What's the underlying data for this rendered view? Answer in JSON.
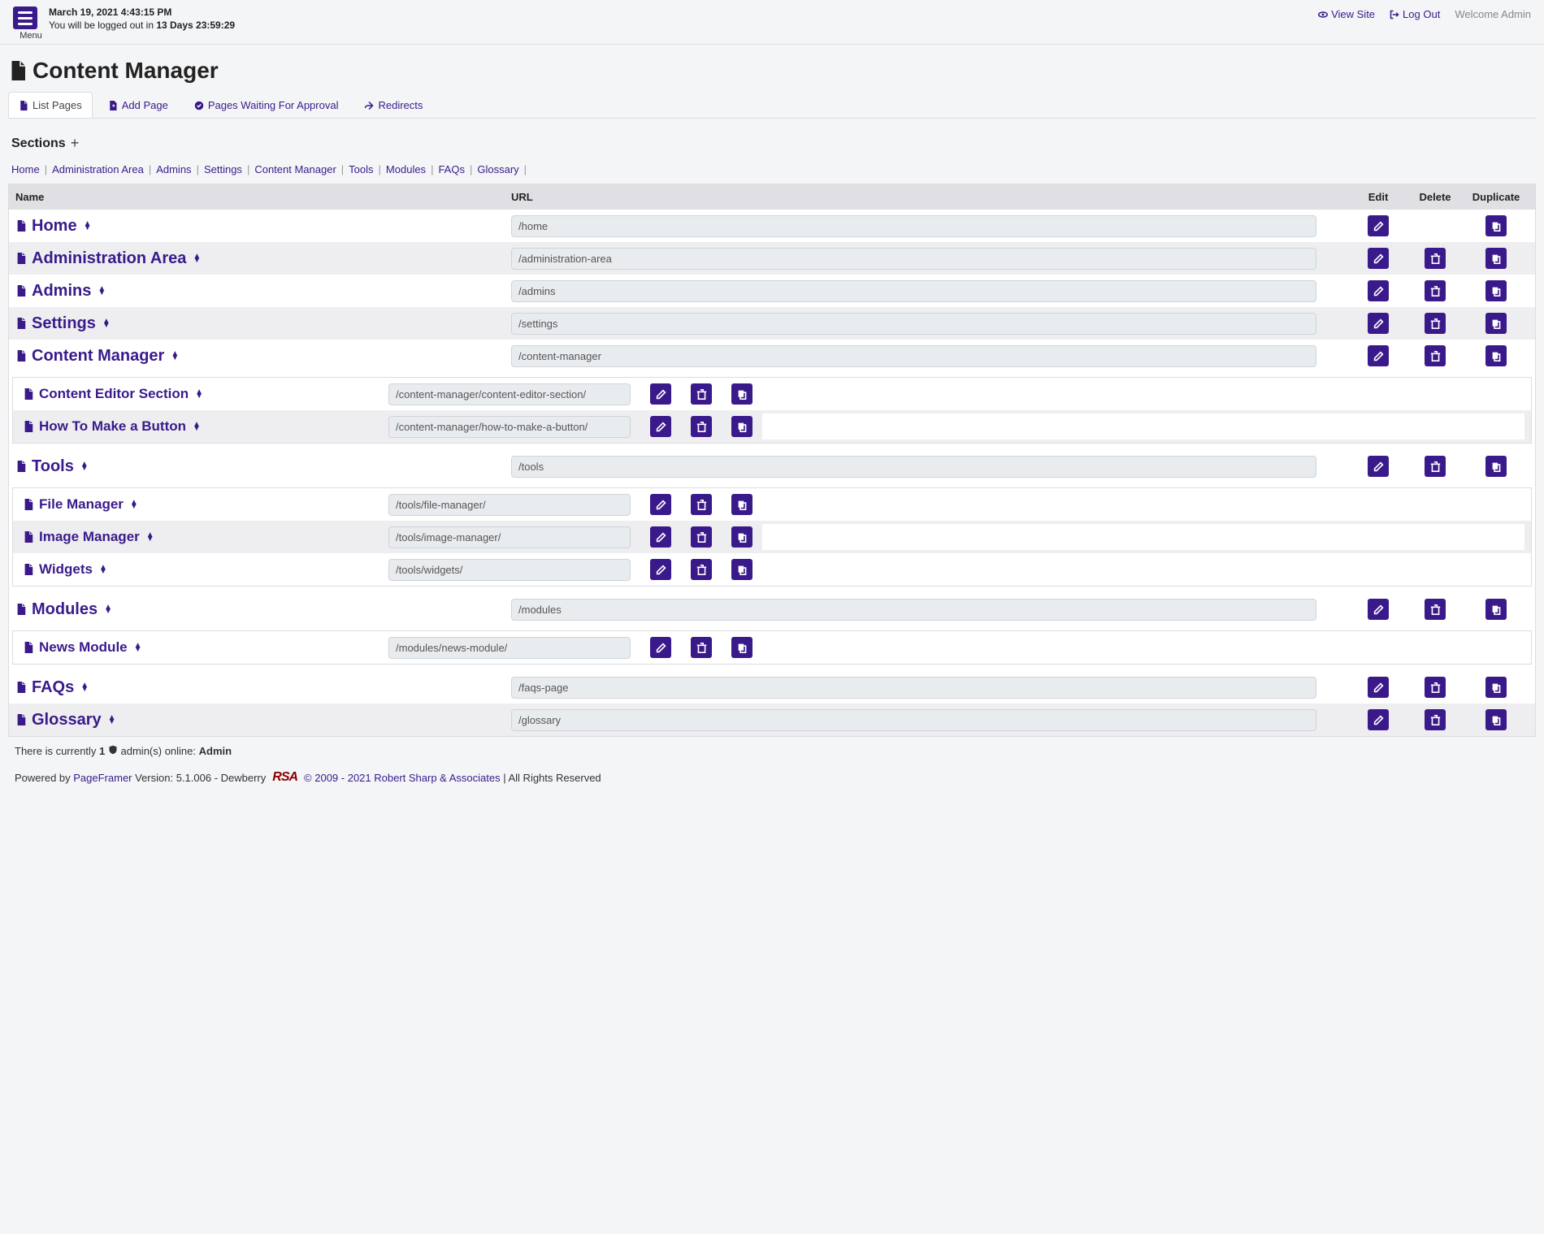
{
  "header": {
    "menu_label": "Menu",
    "datetime": "March 19, 2021 4:43:15 PM",
    "logout_prefix": "You will be logged out in ",
    "logout_countdown": "13 Days 23:59:29",
    "view_site": "View Site",
    "log_out": "Log Out",
    "welcome": "Welcome Admin"
  },
  "page": {
    "title": "Content Manager"
  },
  "tabs": [
    {
      "label": "List Pages",
      "icon": "file-icon",
      "active": true
    },
    {
      "label": "Add Page",
      "icon": "file-plus-icon"
    },
    {
      "label": "Pages Waiting For Approval",
      "icon": "check-circle-icon"
    },
    {
      "label": "Redirects",
      "icon": "redirect-icon"
    }
  ],
  "sections_label": "Sections",
  "breadcrumb": [
    "Home",
    "Administration Area",
    "Admins",
    "Settings",
    "Content Manager",
    "Tools",
    "Modules",
    "FAQs",
    "Glossary"
  ],
  "columns": {
    "name": "Name",
    "url": "URL",
    "edit": "Edit",
    "delete": "Delete",
    "duplicate": "Duplicate"
  },
  "rows": [
    {
      "name": "Home",
      "url": "/home",
      "delete": false
    },
    {
      "name": "Administration Area",
      "url": "/administration-area",
      "delete": true
    },
    {
      "name": "Admins",
      "url": "/admins",
      "delete": true
    },
    {
      "name": "Settings",
      "url": "/settings",
      "delete": true
    },
    {
      "name": "Content Manager",
      "url": "/content-manager",
      "delete": true,
      "children": [
        {
          "name": "Content Editor Section",
          "url": "/content-manager/content-editor-section/"
        },
        {
          "name": "How To Make a Button",
          "url": "/content-manager/how-to-make-a-button/"
        }
      ]
    },
    {
      "name": "Tools",
      "url": "/tools",
      "delete": true,
      "children": [
        {
          "name": "File Manager",
          "url": "/tools/file-manager/"
        },
        {
          "name": "Image Manager",
          "url": "/tools/image-manager/"
        },
        {
          "name": "Widgets",
          "url": "/tools/widgets/"
        }
      ]
    },
    {
      "name": "Modules",
      "url": "/modules",
      "delete": true,
      "children": [
        {
          "name": "News Module",
          "url": "/modules/news-module/"
        }
      ]
    },
    {
      "name": "FAQs",
      "url": "/faqs-page",
      "delete": true
    },
    {
      "name": "Glossary",
      "url": "/glossary",
      "delete": true
    }
  ],
  "footer": {
    "online_prefix": "There is currently ",
    "online_count": "1",
    "online_mid": " admin(s) online: ",
    "online_name": "Admin",
    "powered_prefix": "Powered by ",
    "powered_link": "PageFramer",
    "version": " Version: 5.1.006 - Dewberry",
    "rsa": "RSA",
    "copyright_link": "© 2009 - 2021 Robert Sharp & Associates",
    "copyright_suffix": " | All Rights Reserved"
  }
}
